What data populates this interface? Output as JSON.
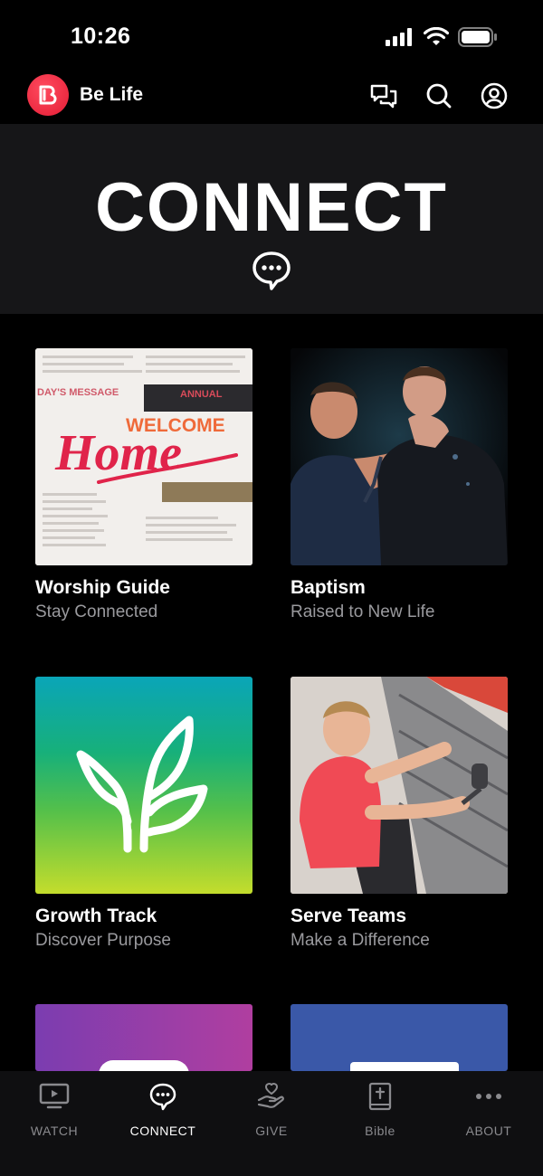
{
  "status_bar": {
    "time": "10:26"
  },
  "header": {
    "app_name": "Be Life"
  },
  "hero": {
    "title": "CONNECT"
  },
  "cards": [
    {
      "title": "Worship Guide",
      "subtitle": "Stay Connected",
      "image_text": {
        "message": "DAY'S MESSAGE",
        "annual": "ANNUAL",
        "welcome": "WELCOME",
        "home": "Home"
      }
    },
    {
      "title": "Baptism",
      "subtitle": "Raised to New Life"
    },
    {
      "title": "Growth Track",
      "subtitle": "Discover Purpose"
    },
    {
      "title": "Serve Teams",
      "subtitle": "Make a Difference"
    }
  ],
  "tab_bar": {
    "tabs": [
      {
        "label": "WATCH"
      },
      {
        "label": "CONNECT"
      },
      {
        "label": "GIVE"
      },
      {
        "label": "Bible"
      },
      {
        "label": "ABOUT"
      }
    ],
    "active": "CONNECT"
  },
  "colors": {
    "brand": "#e8253c",
    "background": "#000000",
    "hero_bg": "#161618",
    "subtitle": "#9a9a9e"
  }
}
